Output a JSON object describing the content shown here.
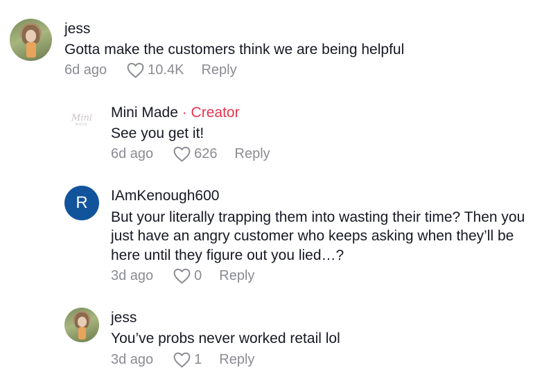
{
  "comments": [
    {
      "author": "jess",
      "text": "Gotta make the customers think we are being helpful",
      "time": "6d ago",
      "likes": "10.4K",
      "reply_label": "Reply",
      "avatar_icon": "user-photo-avatar"
    },
    {
      "author": "Mini Made",
      "badge": "· Creator",
      "text": "See you get it!",
      "time": "6d ago",
      "likes": "626",
      "reply_label": "Reply",
      "avatar_icon": "mini-made-logo-avatar",
      "avatar_text_1": "Mini",
      "avatar_text_2": "MADE"
    },
    {
      "author": "IAmKenough600",
      "text_lines": [
        "But your literally trapping them into wasting their time? Then you",
        "just have an angry customer who keeps asking when they’ll be",
        "here until they figure out you lied…?"
      ],
      "time": "3d ago",
      "likes": "0",
      "reply_label": "Reply",
      "avatar_letter": "R",
      "avatar_color": "#11549c"
    },
    {
      "author": "jess",
      "text": "You’ve probs never worked retail lol",
      "time": "3d ago",
      "likes": "1",
      "reply_label": "Reply",
      "avatar_icon": "user-photo-avatar"
    }
  ],
  "colors": {
    "text": "#161823",
    "meta": "#8a8b91",
    "creator_badge": "#e8334f"
  }
}
